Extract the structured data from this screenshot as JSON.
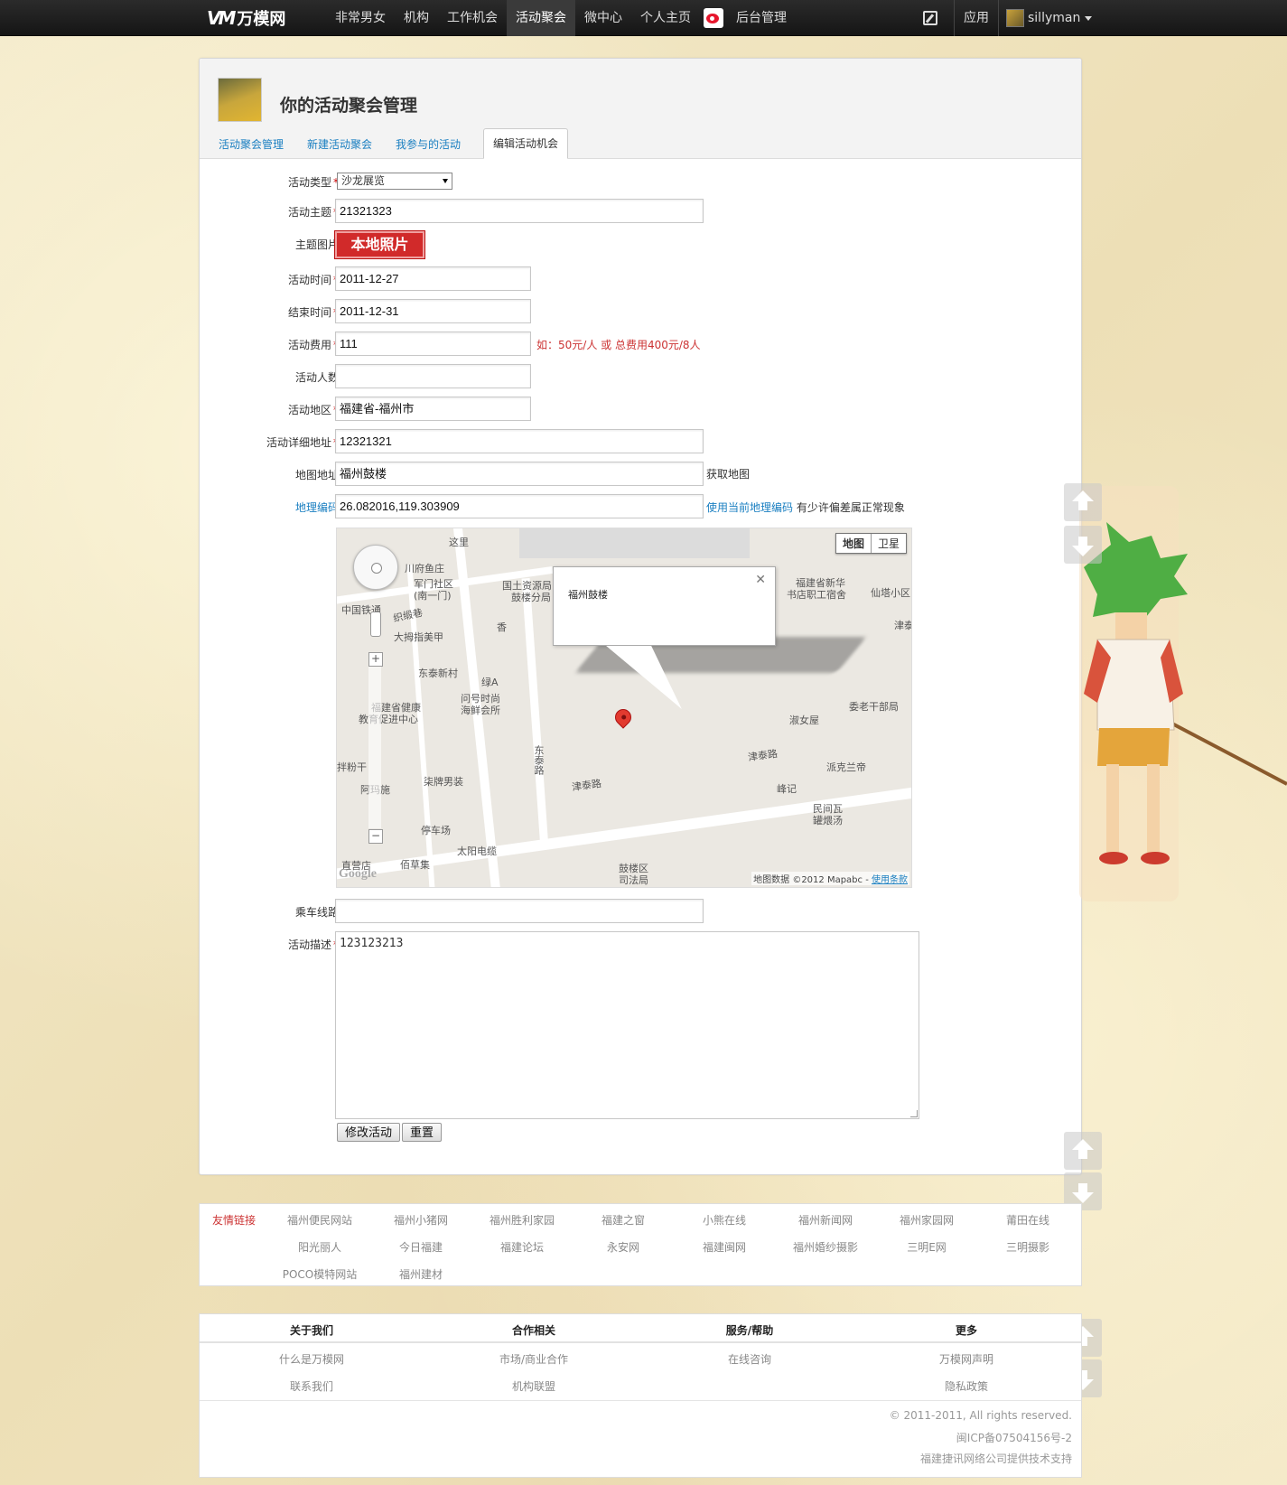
{
  "brand": {
    "logo_mark": "VM",
    "name": "万模网"
  },
  "nav": [
    {
      "label": "非常男女"
    },
    {
      "label": "机构"
    },
    {
      "label": "工作机会"
    },
    {
      "label": "活动聚会",
      "active": true
    },
    {
      "label": "微中心"
    },
    {
      "label": "个人主页"
    },
    {
      "label": "后台管理"
    }
  ],
  "topright": {
    "app_label": "应用",
    "username": "sillyman"
  },
  "page": {
    "title": "你的活动聚会管理",
    "tabs": [
      "活动聚会管理",
      "新建活动聚会",
      "我参与的活动",
      "编辑活动机会"
    ],
    "active_tab": 3
  },
  "form": {
    "type_label": "活动类型",
    "type_value": "沙龙展览",
    "subject_label": "活动主题",
    "subject_value": "21321323",
    "image_label": "主题图片",
    "image_button": "本地照片",
    "start_label": "活动时间",
    "start_value": "2011-12-27",
    "end_label": "结束时间",
    "end_value": "2011-12-31",
    "fee_label": "活动费用",
    "fee_value": "111",
    "fee_hint": "如：50元/人 或 总费用400元/8人",
    "people_label": "活动人数",
    "people_value": "",
    "region_label": "活动地区",
    "region_value": "福建省-福州市",
    "address_label": "活动详细地址",
    "address_value": "12321321",
    "map_addr_label": "地图地址",
    "map_addr_value": "福州鼓楼",
    "get_map_link": "获取地图",
    "geo_label": "地理编码",
    "geo_value": "26.082016,119.303909",
    "use_geo_link": "使用当前地理编码",
    "geo_note": "有少许偏差属正常现象",
    "route_label": "乘车线路",
    "route_value": "",
    "desc_label": "活动描述",
    "desc_value": "123123213",
    "submit_button": "修改活动",
    "reset_button": "重置",
    "required_mark": "*"
  },
  "map": {
    "type_map": "地图",
    "type_sat": "卫星",
    "info_text": "福州鼓楼",
    "attribution": "地图数据 ©2012 Mapabc -",
    "terms_link": "使用条款",
    "google_logo": "Google",
    "labels": {
      "l1": "这里",
      "l2": "川府鱼庄",
      "l3": "军门社区",
      "l4": "(南一门)",
      "l5": "国土资源局",
      "l6": "鼓楼分局",
      "l7": "福建省新华",
      "l8": "书店职工宿舍",
      "l9": "仙塔小区",
      "l10": "中国铁通",
      "l11": "织缎巷",
      "l12": "大拇指美甲",
      "l13": "香",
      "l14": "津泰",
      "l15": "东泰新村",
      "l16": "绿A",
      "l17": "问号时尚",
      "l18": "海鲜会所",
      "l19": "福建省健康",
      "l20": "教育促进中心",
      "l21": "淑女屋",
      "l22": "委老干部局",
      "l23": "津泰路",
      "l24": "派克兰帝",
      "l25": "东泰路",
      "l26": "拌粉干",
      "l27": "柒牌男装",
      "l28": "阿玛施",
      "l29": "峰记",
      "l30": "津泰路",
      "l31": "民间瓦",
      "l32": "罐煨汤",
      "l33": "停车场",
      "l34": "太阳电缆",
      "l35": "佰草集",
      "l36": "鼓楼区",
      "l37": "司法局",
      "l38": "直营店"
    }
  },
  "friends": {
    "title": "友情链接",
    "links": [
      "福州便民网站",
      "福州小猪网",
      "福州胜利家园",
      "福建之窗",
      "小熊在线",
      "福州新闻网",
      "福州家园网",
      "莆田在线",
      "阳光丽人",
      "今日福建",
      "福建论坛",
      "永安网",
      "福建闽网",
      "福州婚纱摄影",
      "三明E网",
      "三明摄影",
      "POCO模特网站",
      "福州建材"
    ]
  },
  "footer": {
    "heads": [
      "关于我们",
      "合作相关",
      "服务/帮助",
      "更多"
    ],
    "row1": [
      "什么是万模网",
      "市场/商业合作",
      "在线咨询",
      "万模网声明"
    ],
    "row2": [
      "联系我们",
      "机构联盟",
      "",
      "隐私政策"
    ],
    "copyright": "© 2011-2011, All rights reserved.",
    "icp": "闽ICP备07504156号-2",
    "support": "福建捷讯网络公司提供技术支持"
  },
  "icons": [
    "edit-icon",
    "weibo-icon",
    "caret-down-icon",
    "map-pan-control",
    "map-zoom-in-icon",
    "map-zoom-out-icon",
    "map-marker-icon",
    "scroll-up-icon",
    "scroll-down-icon"
  ]
}
